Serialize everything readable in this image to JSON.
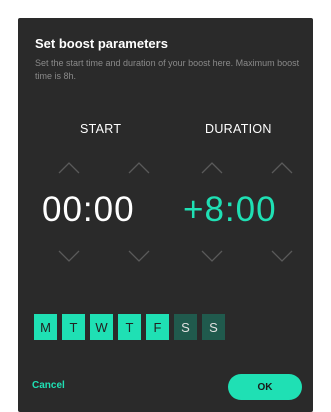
{
  "dialog": {
    "title": "Set boost parameters",
    "description": "Set the start time and duration of your boost here. Maximum boost time is 8h."
  },
  "start": {
    "label": "START",
    "value": "00:00"
  },
  "duration": {
    "label": "DURATION",
    "value": "+8:00"
  },
  "days": [
    {
      "label": "M",
      "selected": true
    },
    {
      "label": "T",
      "selected": true
    },
    {
      "label": "W",
      "selected": true
    },
    {
      "label": "T",
      "selected": true
    },
    {
      "label": "F",
      "selected": true
    },
    {
      "label": "S",
      "selected": false
    },
    {
      "label": "S",
      "selected": false
    }
  ],
  "actions": {
    "cancel_label": "Cancel",
    "ok_label": "OK"
  },
  "colors": {
    "accent": "#1fe0b4",
    "panel": "#2a2a2a",
    "day_off": "#205a4d",
    "chevron": "#5a5a5a"
  },
  "icons": {
    "up": "chevron-up-icon",
    "down": "chevron-down-icon"
  }
}
